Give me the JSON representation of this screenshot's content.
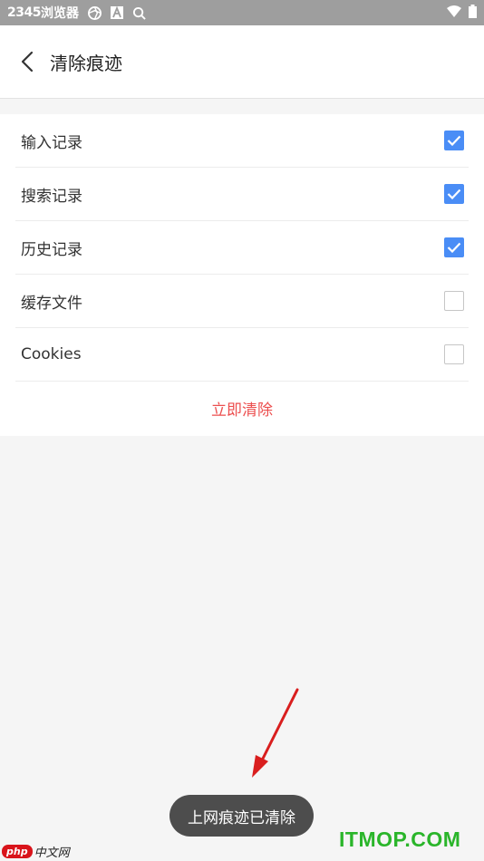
{
  "status_bar": {
    "time": "2345",
    "app_name": "浏览器"
  },
  "header": {
    "title": "清除痕迹"
  },
  "options": [
    {
      "label": "输入记录",
      "checked": true
    },
    {
      "label": "搜索记录",
      "checked": true
    },
    {
      "label": "历史记录",
      "checked": true
    },
    {
      "label": "缓存文件",
      "checked": false
    },
    {
      "label": "Cookies",
      "checked": false
    }
  ],
  "clear_button": {
    "label": "立即清除",
    "color": "#ec4f4f"
  },
  "toast": {
    "text": "上网痕迹已清除"
  },
  "watermarks": {
    "left_badge": "php",
    "left_text": "中文网",
    "right_text": "ITMOP.COM"
  },
  "colors": {
    "checkbox_checked": "#4a8df6",
    "status_bar": "#9e9e9e"
  }
}
